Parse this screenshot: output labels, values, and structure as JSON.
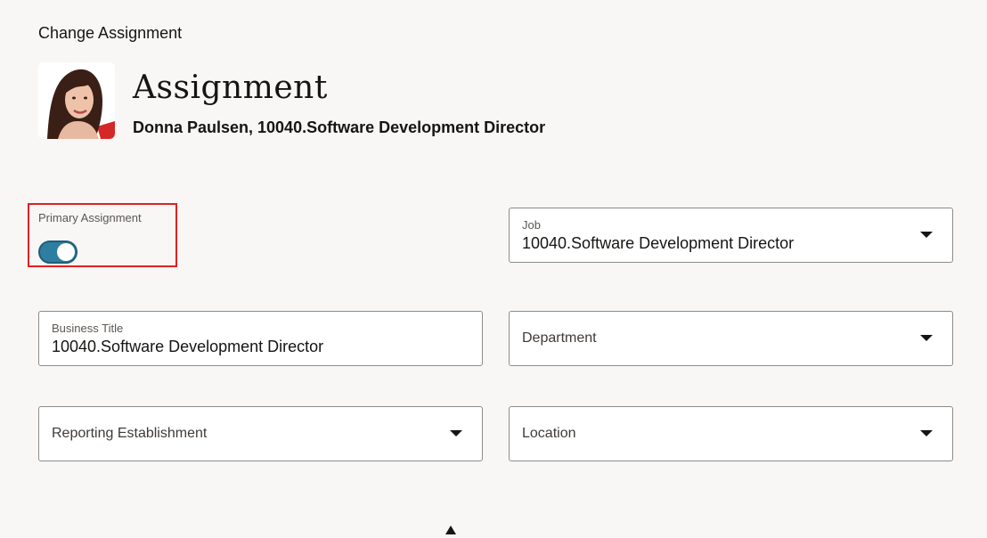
{
  "page": {
    "title": "Change Assignment"
  },
  "header": {
    "heading": "Assignment",
    "subheading": "Donna Paulsen, 10040.Software Development Director",
    "avatar_icon": "person-photo"
  },
  "primary_assignment": {
    "label": "Primary Assignment",
    "checked": true,
    "accent_color": "#2e7ea1",
    "highlight_color": "#e02020"
  },
  "fields": {
    "job": {
      "label": "Job",
      "value": "10040.Software Development Director"
    },
    "business_title": {
      "label": "Business Title",
      "value": "10040.Software Development Director"
    },
    "department": {
      "label": "Department"
    },
    "reporting_establishment": {
      "label": "Reporting Establishment"
    },
    "location": {
      "label": "Location"
    }
  }
}
